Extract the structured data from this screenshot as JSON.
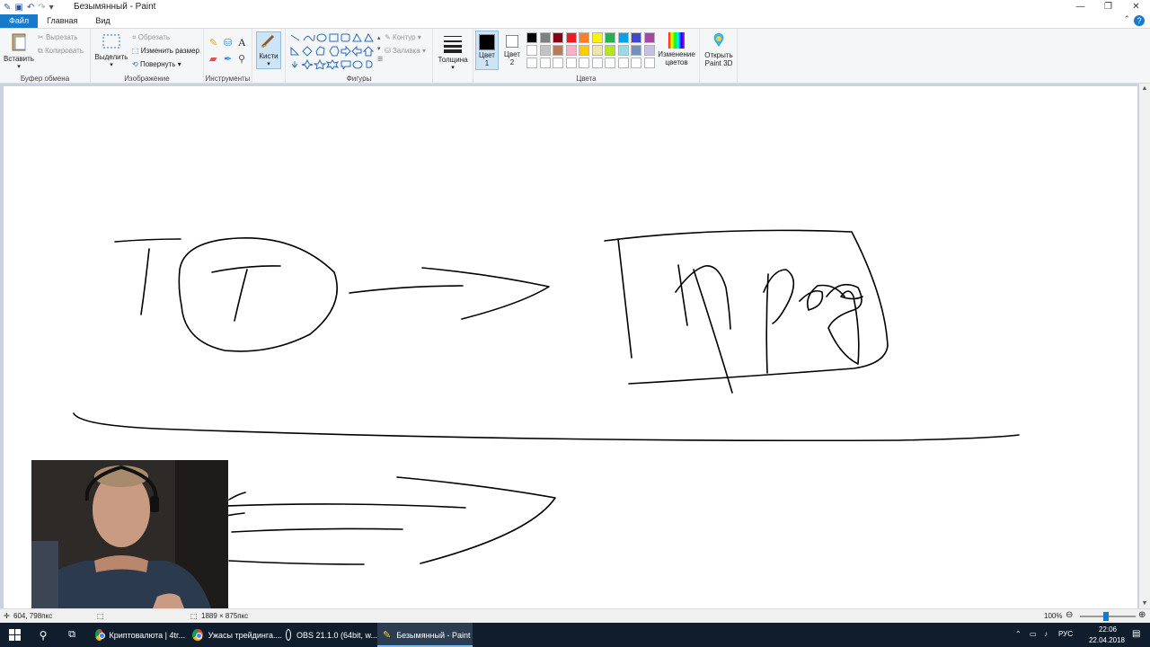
{
  "window": {
    "title": "Безымянный - Paint",
    "controls": [
      "—",
      "❐",
      "✕"
    ]
  },
  "tabs": [
    "Файл",
    "Главная",
    "Вид"
  ],
  "ribbon": {
    "clipboard": {
      "label": "Буфер обмена",
      "paste": "Вставить",
      "cut": "Вырезать",
      "copy": "Копировать"
    },
    "image": {
      "label": "Изображение",
      "select": "Выделить",
      "crop": "Обрезать",
      "resize": "Изменить размер",
      "rotate": "Повернуть"
    },
    "tools": {
      "label": "Инструменты"
    },
    "brushes": {
      "label": "Кисти"
    },
    "shapes": {
      "label": "Фигуры",
      "outline": "Контур",
      "fill": "Заливка"
    },
    "size": {
      "label": "Толщина"
    },
    "colors": {
      "label": "Цвета",
      "color1": "Цвет 1",
      "color2": "Цвет 2",
      "edit": "Изменение цветов",
      "palette_row1": [
        "#000000",
        "#7f7f7f",
        "#880015",
        "#ed1c24",
        "#ff7f27",
        "#fff200",
        "#22b14c",
        "#00a2e8",
        "#3f48cc",
        "#a349a4"
      ],
      "palette_row2": [
        "#ffffff",
        "#c3c3c3",
        "#b97a57",
        "#ffaec9",
        "#ffc90e",
        "#efe4b0",
        "#b5e61d",
        "#99d9ea",
        "#7092be",
        "#c8bfe7"
      ]
    },
    "paint3d": "Открыть Paint 3D"
  },
  "status": {
    "cursor": "604, 798пкс",
    "size": "1889 × 875пкс",
    "zoom": "100%"
  },
  "taskbar": {
    "items": [
      "Криптовалюта | 4tr...",
      "Ужасы трейдинга....",
      "OBS 21.1.0 (64bit, w...",
      "Безымянный - Paint"
    ],
    "lang": "РУС",
    "time": "22:06",
    "date": "22.04.2018"
  },
  "colors": {
    "accent": "#1979ca",
    "taskbar": "#0f1d2c",
    "workspace": "#c9d3e2"
  }
}
